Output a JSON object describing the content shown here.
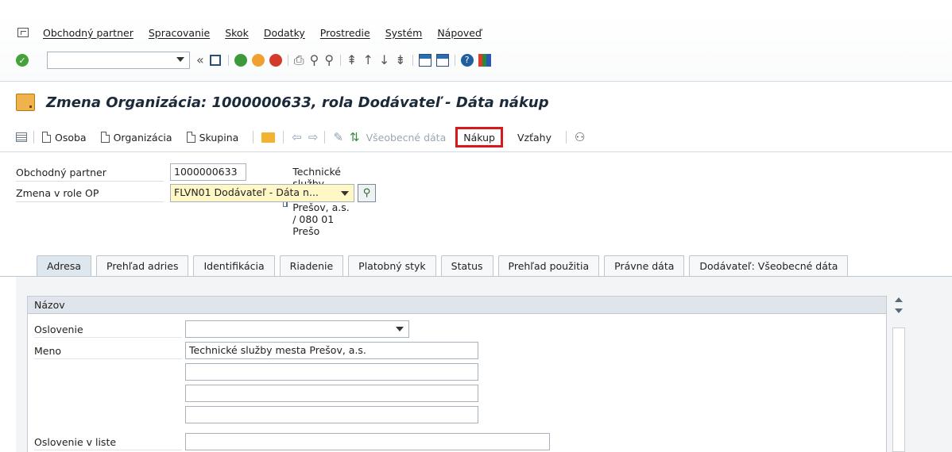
{
  "menu": {
    "items": [
      "Obchodný partner",
      "Spracovanie",
      "Skok",
      "Dodatky",
      "Prostredie",
      "Systém",
      "Nápoveď"
    ]
  },
  "toolbar": {
    "command_value": ""
  },
  "title": "Zmena Organizácia: 1000000633, rola Dodávateľ - Dáta nákup",
  "appbar": {
    "osoba": "Osoba",
    "organizacia": "Organizácia",
    "skupina": "Skupina",
    "vseobecne_data": "Všeobecné dáta",
    "nakup": "Nákup",
    "vztahy": "Vzťahy"
  },
  "form": {
    "partner_label": "Obchodný partner",
    "partner_value": "1000000633",
    "partner_desc": "Technické služby mesta Prešov, a.s. / 080 01 Prešo",
    "role_label": "Zmena v role OP",
    "role_value": "FLVN01 Dodávateľ - Dáta n..."
  },
  "tabs": [
    "Adresa",
    "Prehľad adries",
    "Identifikácia",
    "Riadenie",
    "Platobný styk",
    "Status",
    "Prehľad použitia",
    "Právne dáta",
    "Dodávateľ: Všeobecné dáta"
  ],
  "group": {
    "title": "Názov",
    "oslovenie_label": "Oslovenie",
    "oslovenie_value": "",
    "meno_label": "Meno",
    "meno_value": "Technické služby mesta Prešov, a.s.",
    "meno2": "",
    "meno3": "",
    "meno4": "",
    "oslovenie_v_liste_label": "Oslovenie v liste",
    "oslovenie_v_liste_value": ""
  },
  "colors": {
    "highlight": "#d7191c",
    "required_field": "#fff8c6"
  }
}
